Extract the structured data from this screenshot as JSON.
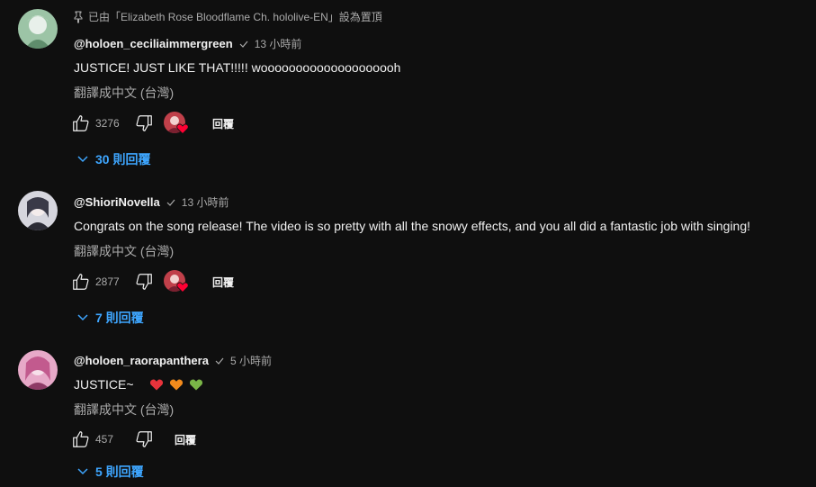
{
  "comments": [
    {
      "pinned_text": "已由「Elizabeth Rose Bloodflame Ch. hololive-EN」設為置頂",
      "author": "@holoen_ceciliaimmergreen",
      "time": "13 小時前",
      "text": "JUSTICE! JUST LIKE THAT!!!!! woooooooooooooooooooh",
      "translate": "翻譯成中文 (台灣)",
      "likes": "3276",
      "reply_label": "回覆",
      "replies": "30 則回覆",
      "creator_heart": true,
      "avatar_color": "#8fb59a"
    },
    {
      "author": "@ShioriNovella",
      "time": "13 小時前",
      "text": "Congrats on the song release! The video is so pretty with all the snowy effects, and you all did a fantastic job with singing!",
      "translate": "翻譯成中文 (台灣)",
      "likes": "2877",
      "reply_label": "回覆",
      "replies": "7 則回覆",
      "creator_heart": true,
      "avatar_color": "#b9b9c4"
    },
    {
      "author": "@holoen_raorapanthera",
      "time": "5 小時前",
      "text": "JUSTICE~",
      "emojis": [
        "red-heart",
        "orange-heart",
        "green-heart"
      ],
      "translate": "翻譯成中文 (台灣)",
      "likes": "457",
      "reply_label": "回覆",
      "replies": "5 則回覆",
      "creator_heart": false,
      "avatar_color": "#d98fb0"
    }
  ],
  "colors": {
    "background": "#0f0f0f",
    "link_blue": "#3ea6ff",
    "secondary_text": "#aaaaaa",
    "heart_red": "#ff0033"
  }
}
